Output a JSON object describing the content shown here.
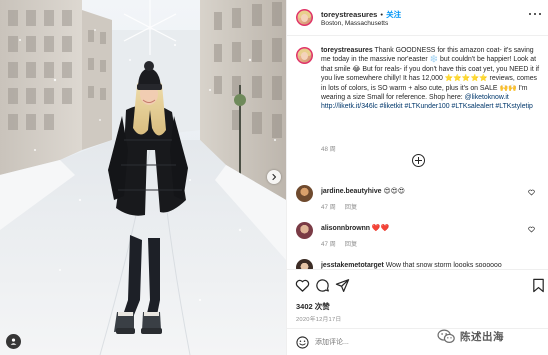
{
  "post": {
    "image_alt": "Woman in black puffer coat standing in snowy city street",
    "carousel_next_icon": "chevron-right-icon",
    "user_tag_icon": "user-tag-icon"
  },
  "header": {
    "username": "toreystreasures",
    "separator": "•",
    "follow_label": "关注",
    "location": "Boston, Massachusetts",
    "more_icon": "ellipsis-icon"
  },
  "caption": {
    "username": "toreystreasures",
    "text": "Thank GOODNESS for this amazon coat- it's saving me today in the massive nor'easter ❄️ but couldn't be happier! Look at that smile 😂 But for reals- if you don't have this coat yet, you NEED it if you live somewhere chilly! It has 12,000 ⭐⭐⭐⭐⭐ reviews, comes in lots of colors, is SO warm + also cute, plus it's on SALE 🙌🙌 I'm wearing a size Small for reference. Shop here: ",
    "link_handle": "@liketoknow.it",
    "link_url": "http://liketk.it/346lc",
    "link_handle_2": "#liketkit",
    "hashtags": "#LTKunder100 #LTKsalealert #LTKstyletip",
    "age": "48 周"
  },
  "load_more_icon": "plus-circle-icon",
  "comments": [
    {
      "username": "jardine.beautyhive",
      "text": "😍😍😍",
      "age": "47 周",
      "reply_label": "回复"
    },
    {
      "username": "alisonnbrownn",
      "text": "❤️❤️",
      "age": "47 周",
      "reply_label": "回复"
    },
    {
      "username": "jesstakemetotarget",
      "text": "Wow that snow storm loooks soooooo",
      "age": "",
      "reply_label": ""
    }
  ],
  "actions": {
    "like_icon": "heart-icon",
    "comment_icon": "comment-icon",
    "share_icon": "share-icon",
    "save_icon": "bookmark-icon",
    "likes_count": "3402",
    "likes_label": "次赞",
    "date": "2020年12月17日"
  },
  "add_comment": {
    "emoji_icon": "emoji-icon",
    "placeholder": "添加评论..."
  },
  "watermark": {
    "text": "陈述出海"
  },
  "colors": {
    "follow": "#0095f6",
    "hashtag": "#00376b",
    "muted": "#8e8e8e",
    "text": "#262626",
    "heart_red": "#ed4956"
  }
}
